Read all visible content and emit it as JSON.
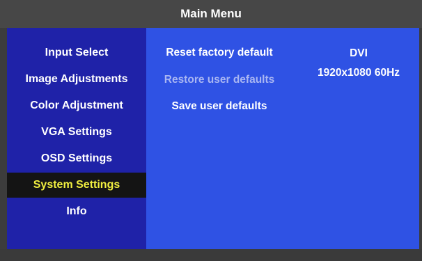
{
  "header": {
    "title": "Main Menu"
  },
  "sidebar": {
    "items": [
      {
        "label": "Input Select"
      },
      {
        "label": "Image Adjustments"
      },
      {
        "label": "Color Adjustment"
      },
      {
        "label": "VGA Settings"
      },
      {
        "label": "OSD Settings"
      },
      {
        "label": "System Settings",
        "selected": true
      },
      {
        "label": "Info"
      }
    ]
  },
  "main": {
    "options": [
      {
        "label": "Reset factory default",
        "enabled": true
      },
      {
        "label": "Restore user defaults",
        "enabled": false
      },
      {
        "label": "Save user defaults",
        "enabled": true
      }
    ],
    "signal": {
      "input": "DVI",
      "resolution": "1920x1080 60Hz"
    }
  },
  "colors": {
    "sidebar_bg": "#1f22a8",
    "main_bg": "#2f52e4",
    "selected_bg": "#141414",
    "selected_text": "#f2f040",
    "disabled_text": "#a9b6f2"
  }
}
